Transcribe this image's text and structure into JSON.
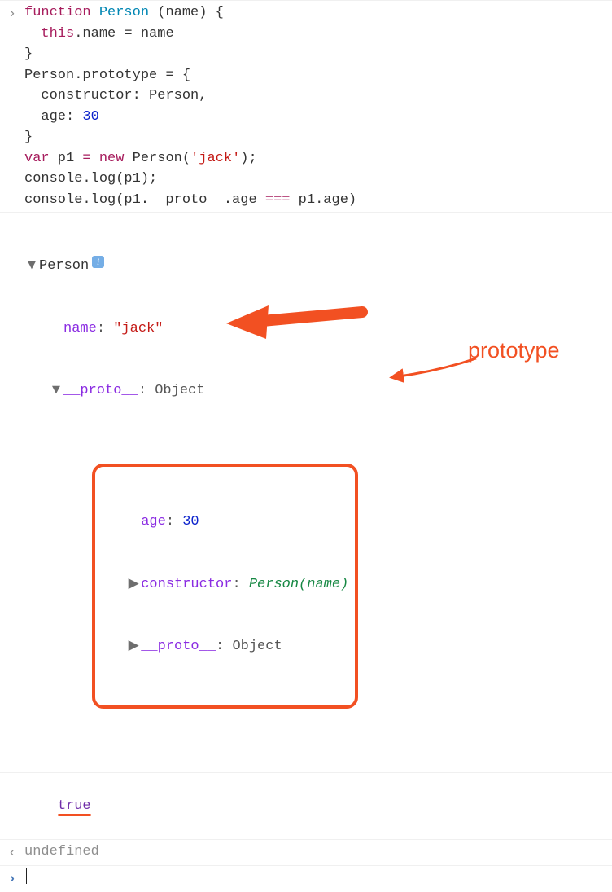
{
  "code": {
    "line1": {
      "kw": "function",
      "name": "Person",
      "params": "(name)",
      "brace": " {"
    },
    "line2": {
      "indent": "  ",
      "this": "this",
      "dot": ".",
      "prop": "name",
      "eq": " = ",
      "rhs": "name"
    },
    "line3": "}",
    "line4": {
      "obj": "Person",
      "dot": ".",
      "prop": "prototype",
      "eq": " = ",
      "brace": "{"
    },
    "line5": {
      "indent": "  ",
      "key": "constructor",
      "colon": ": ",
      "val": "Person",
      "comma": ","
    },
    "line6": {
      "indent": "  ",
      "key": "age",
      "colon": ": ",
      "val": "30"
    },
    "line7": "}",
    "line8": {
      "var": "var",
      "name": " p1 ",
      "eq": "= ",
      "new": "new",
      "call": " Person(",
      "str": "'jack'",
      "end": ");"
    },
    "line9": "console.log(p1);",
    "line10": {
      "pre": "console.log(p1.",
      "proto": "__proto__",
      "mid": ".age ",
      "op": "===",
      "post": " p1.age)"
    }
  },
  "explorer": {
    "root": "Person",
    "nameKey": "name",
    "nameColonSpace": ": ",
    "nameVal": "\"jack\"",
    "proto1Key": "__proto__",
    "proto1ColonSpace": ": ",
    "proto1Val": "Object",
    "ageKey": "age",
    "ageColonSpace": ": ",
    "ageVal": "30",
    "ctorKey": "constructor",
    "ctorColonSpace": ": ",
    "ctorVal": "Person(name)",
    "proto2Key": "__proto__",
    "proto2ColonSpace": ": ",
    "proto2Val": "Object"
  },
  "result_true": "true",
  "undefined": "undefined",
  "annotation": "prototype",
  "glyph": {
    "down": "▼",
    "right": "▶",
    "prompt": "›",
    "return": "‹"
  }
}
